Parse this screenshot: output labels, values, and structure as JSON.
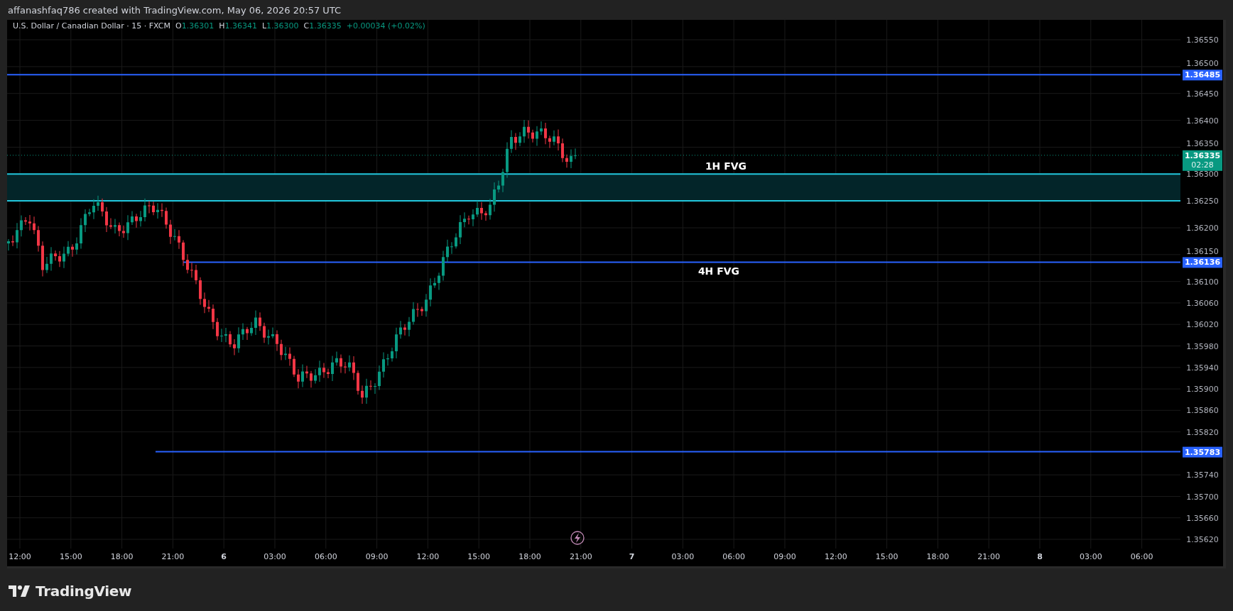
{
  "header": {
    "caption": "affanashfaq786 created with TradingView.com, May 06, 2026 20:57 UTC"
  },
  "legend": {
    "title": "U.S. Dollar / Canadian Dollar · 15 · FXCM",
    "ohlc": [
      {
        "label": "O",
        "value": "1.36301"
      },
      {
        "label": "H",
        "value": "1.36341"
      },
      {
        "label": "L",
        "value": "1.36300"
      },
      {
        "label": "C",
        "value": "1.36335"
      }
    ],
    "change": "+0.00034 (+0.02%)"
  },
  "drawings": [
    {
      "kind": "line",
      "price": "1.36485"
    },
    {
      "kind": "zone",
      "label": "1H FVG"
    },
    {
      "kind": "line",
      "price": "1.36136",
      "label": "4H FVG"
    },
    {
      "kind": "line",
      "price": "1.35783"
    }
  ],
  "current_price": {
    "price": "1.36335",
    "countdown": "02:28"
  },
  "price_axis": [
    "1.36550",
    "1.36500",
    "1.36450",
    "1.36400",
    "1.36350",
    "1.36300",
    "1.36250",
    "1.36200",
    "1.36150",
    "1.36100",
    "1.36060",
    "1.36020",
    "1.35980",
    "1.35940",
    "1.35900",
    "1.35860",
    "1.35820",
    "1.35740",
    "1.35700",
    "1.35660",
    "1.35620"
  ],
  "time_axis": [
    "12:00",
    "15:00",
    "18:00",
    "21:00",
    "6",
    "03:00",
    "06:00",
    "09:00",
    "12:00",
    "15:00",
    "18:00",
    "21:00",
    "7",
    "03:00",
    "06:00",
    "09:00",
    "12:00",
    "15:00",
    "18:00",
    "21:00",
    "8",
    "03:00",
    "06:00"
  ],
  "footer": {
    "brand": "TradingView"
  }
}
